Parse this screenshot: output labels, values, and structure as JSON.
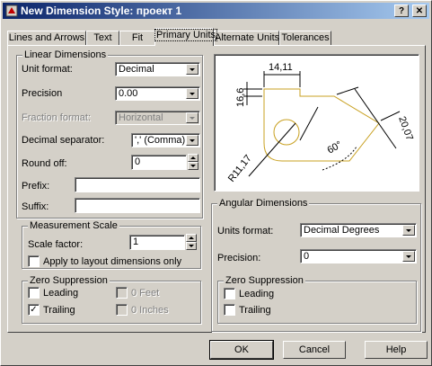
{
  "window": {
    "title": "New Dimension Style: проект 1",
    "help_button": "?",
    "close_button": "✕"
  },
  "tabs": [
    "Lines and Arrows",
    "Text",
    "Fit",
    "Primary Units",
    "Alternate Units",
    "Tolerances"
  ],
  "active_tab": "Primary Units",
  "linear": {
    "title": "Linear Dimensions",
    "unit_format_label": "Unit format:",
    "unit_format_value": "Decimal",
    "precision_label": "Precision",
    "precision_value": "0.00",
    "fraction_format_label": "Fraction format:",
    "fraction_format_value": "Horizontal",
    "decimal_separator_label": "Decimal separator:",
    "decimal_separator_value": "',' (Comma)",
    "round_off_label": "Round off:",
    "round_off_value": "0",
    "prefix_label": "Prefix:",
    "prefix_value": "",
    "suffix_label": "Suffix:",
    "suffix_value": ""
  },
  "measurement_scale": {
    "title": "Measurement Scale",
    "scale_factor_label": "Scale factor:",
    "scale_factor_value": "1",
    "apply_layout_label": "Apply to layout dimensions only",
    "apply_layout_checked": false
  },
  "zero_left": {
    "title": "Zero Suppression",
    "leading_label": "Leading",
    "leading_checked": false,
    "trailing_label": "Trailing",
    "trailing_checked": true,
    "feet_label": "0 Feet",
    "inches_label": "0 Inches"
  },
  "preview": {
    "dim_top": "14,11",
    "dim_left": "16,6",
    "dim_right": "20,07",
    "dim_angle": "60°",
    "dim_radius": "R11,17"
  },
  "angular": {
    "title": "Angular Dimensions",
    "units_format_label": "Units format:",
    "units_format_value": "Decimal Degrees",
    "precision_label": "Precision:",
    "precision_value": "0"
  },
  "zero_right": {
    "title": "Zero Suppression",
    "leading_label": "Leading",
    "leading_checked": false,
    "trailing_label": "Trailing",
    "trailing_checked": false
  },
  "buttons": {
    "ok": "OK",
    "cancel": "Cancel",
    "help": "Help"
  },
  "colors": {
    "title_start": "#0a246a",
    "title_end": "#a6caf0",
    "face": "#d4d0c8",
    "preview_geometry": "#c8a020"
  }
}
